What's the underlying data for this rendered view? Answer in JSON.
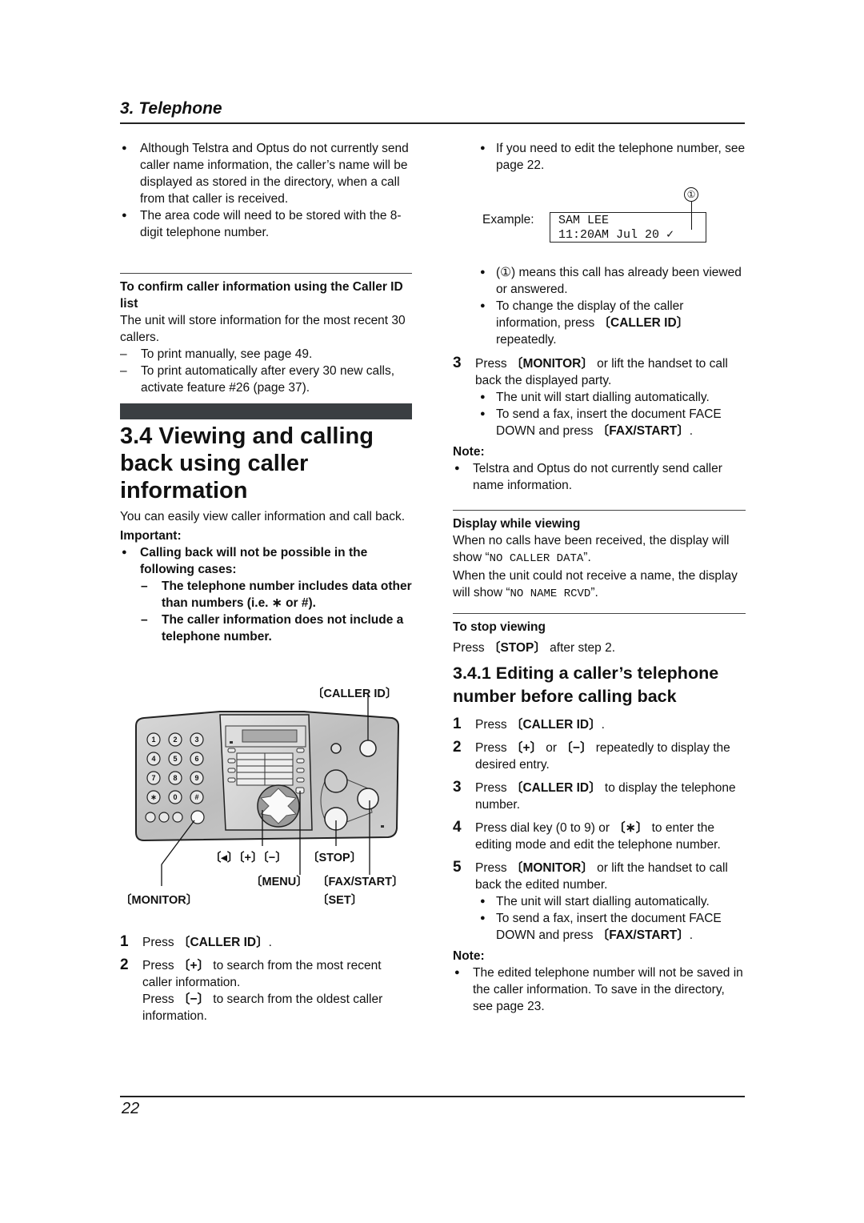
{
  "header": {
    "chapter": "3. Telephone"
  },
  "footer": {
    "page_number": "22"
  },
  "left": {
    "intro_bullets": [
      "Although Telstra and Optus do not currently send caller name information, the caller’s name will be displayed as stored in the directory, when a call from that caller is received.",
      "The area code will need to be stored with the 8-digit telephone number."
    ],
    "confirm": {
      "heading": "To confirm caller information using the Caller ID list",
      "text": "The unit will store information for the most recent 30 callers.",
      "dashes": [
        "To print manually, see page 49.",
        "To print automatically after every 30 new calls, activate feature #26 (page 37)."
      ]
    },
    "section": {
      "title": "3.4 Viewing and calling back using caller information",
      "intro": "You can easily view caller information and call back.",
      "important_label": "Important:",
      "important_bullet": "Calling back will not be possible in the following cases:",
      "important_dashes": [
        "The telephone number includes data other than numbers (i.e. ∗ or #).",
        "The caller information does not include a telephone number."
      ]
    },
    "diagram": {
      "labels": {
        "caller_id": "〔CALLER ID〕",
        "nav": "〔◂〕〔+〕〔−〕",
        "stop": "〔STOP〕",
        "menu": "〔MENU〕",
        "fax_start": "〔FAX/START〕",
        "monitor": "〔MONITOR〕",
        "set": "〔SET〕"
      },
      "keypad": [
        "1",
        "2",
        "3",
        "4",
        "5",
        "6",
        "7",
        "8",
        "9",
        "∗",
        "0",
        "#"
      ]
    },
    "steps": [
      {
        "n": "1",
        "pre": "Press ",
        "key": "〔CALLER ID〕",
        "post": "."
      },
      {
        "n": "2",
        "pre": "Press ",
        "key": "〔+〕",
        "post": " to search from the most recent caller information.",
        "extra_pre": "Press ",
        "extra_key": "〔−〕",
        "extra_post": " to search from the oldest caller information."
      }
    ]
  },
  "right": {
    "edit_bullet": "If you need to edit the telephone number, see page 22.",
    "example": {
      "label": "Example:",
      "line1": "SAM LEE",
      "line2": "11:20AM Jul 20 ✓",
      "marker": "①"
    },
    "bullets_after": [
      "(①) means this call has already been viewed or answered.",
      {
        "pre": "To change the display of the caller information, press ",
        "key": "〔CALLER ID〕",
        "post": " repeatedly."
      }
    ],
    "step3": {
      "n": "3",
      "pre": "Press ",
      "key": "〔MONITOR〕",
      "post": " or lift the handset to call back the displayed party.",
      "bullets": [
        "The unit will start dialling automatically.",
        {
          "pre": "To send a fax, insert the document FACE DOWN and press ",
          "key": "〔FAX/START〕",
          "post": "."
        }
      ]
    },
    "note1": {
      "label": "Note:",
      "text": "Telstra and Optus do not currently send caller name information."
    },
    "display_while_viewing": {
      "heading": "Display while viewing",
      "t1_pre": "When no calls have been received, the display will show “",
      "t1_mono": "NO CALLER DATA",
      "t1_post": "”.",
      "t2_pre": "When the unit could not receive a name, the display will show “",
      "t2_mono": "NO NAME RCVD",
      "t2_post": "”."
    },
    "stop_viewing": {
      "heading": "To stop viewing",
      "pre": "Press ",
      "key": "〔STOP〕",
      "post": " after step 2."
    },
    "subsection": {
      "title": "3.4.1 Editing a caller’s telephone number before calling back",
      "steps": [
        {
          "n": "1",
          "pre": "Press ",
          "key": "〔CALLER ID〕",
          "post": "."
        },
        {
          "n": "2",
          "pre": "Press ",
          "key": "〔+〕",
          "mid": " or ",
          "key2": "〔−〕",
          "post": " repeatedly to display the desired entry."
        },
        {
          "n": "3",
          "pre": "Press ",
          "key": "〔CALLER ID〕",
          "post": " to display the telephone number."
        },
        {
          "n": "4",
          "pre": "Press dial key (0 to 9) or ",
          "key": "〔∗〕",
          "post": " to enter the editing mode and edit the telephone number."
        },
        {
          "n": "5",
          "pre": "Press ",
          "key": "〔MONITOR〕",
          "post": " or lift the handset to call back the edited number."
        }
      ],
      "step5_bullets": [
        "The unit will start dialling automatically.",
        {
          "pre": "To send a fax, insert the document FACE DOWN and press ",
          "key": "〔FAX/START〕",
          "post": "."
        }
      ],
      "note": {
        "label": "Note:",
        "text": "The edited telephone number will not be saved in the caller information. To save in the directory, see page 23."
      }
    }
  }
}
